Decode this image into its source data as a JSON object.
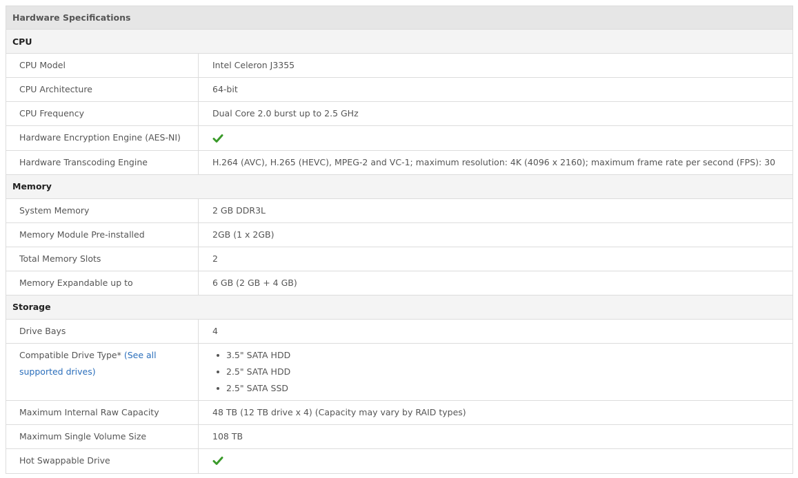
{
  "header": {
    "title": "Hardware Specifications"
  },
  "sections": [
    {
      "title": "CPU",
      "rows": [
        {
          "label": "CPU Model",
          "value": "Intel Celeron J3355"
        },
        {
          "label": "CPU Architecture",
          "value": "64-bit"
        },
        {
          "label": "CPU Frequency",
          "value": "Dual Core 2.0 burst up to 2.5 GHz"
        },
        {
          "label": "Hardware Encryption Engine (AES-NI)",
          "value_icon": "check-icon"
        },
        {
          "label": "Hardware Transcoding Engine",
          "value": "H.264 (AVC), H.265 (HEVC), MPEG-2 and VC-1; maximum resolution: 4K (4096 x 2160); maximum frame rate per second (FPS): 30"
        }
      ]
    },
    {
      "title": "Memory",
      "rows": [
        {
          "label": "System Memory",
          "value": "2 GB DDR3L"
        },
        {
          "label": "Memory Module Pre-installed",
          "value": "2GB (1 x 2GB)"
        },
        {
          "label": "Total Memory Slots",
          "value": "2"
        },
        {
          "label": "Memory Expandable up to",
          "value": "6 GB (2 GB + 4 GB)"
        }
      ]
    },
    {
      "title": "Storage",
      "rows": [
        {
          "label": "Drive Bays",
          "value": "4"
        },
        {
          "label": "Compatible Drive Type*",
          "label_link": "(See all supported drives)",
          "value_list": [
            "3.5\" SATA HDD",
            "2.5\" SATA HDD",
            "2.5\" SATA SSD"
          ]
        },
        {
          "label": "Maximum Internal Raw Capacity",
          "value": "48 TB (12 TB drive x 4) (Capacity may vary by RAID types)"
        },
        {
          "label": "Maximum Single Volume Size",
          "value": "108 TB"
        },
        {
          "label": "Hot Swappable Drive",
          "value_icon": "check-icon"
        }
      ]
    }
  ],
  "colors": {
    "check": "#3a9a2a",
    "link": "#2a6ebb",
    "header_bg": "#e6e6e6",
    "section_bg": "#f4f4f4",
    "border": "#dcdcdc"
  }
}
